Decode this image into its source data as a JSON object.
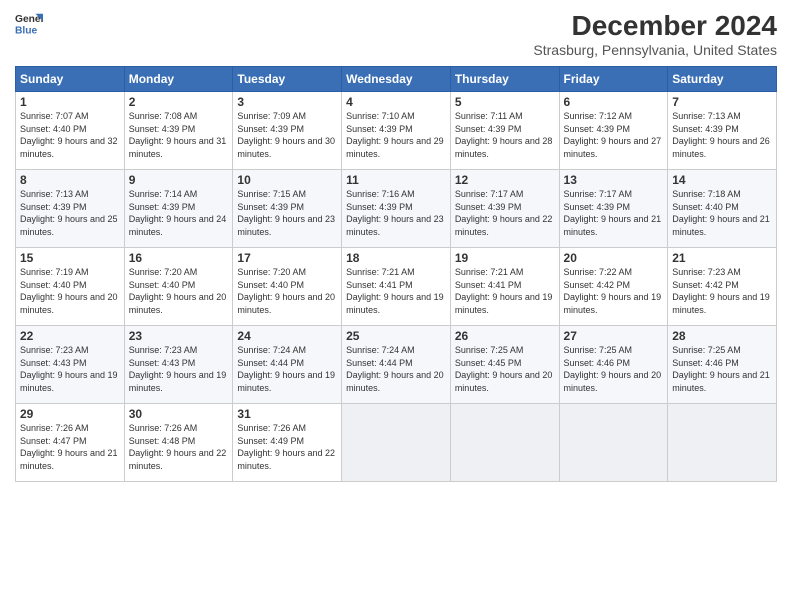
{
  "logo": {
    "line1": "General",
    "line2": "Blue"
  },
  "title": "December 2024",
  "subtitle": "Strasburg, Pennsylvania, United States",
  "days_header": [
    "Sunday",
    "Monday",
    "Tuesday",
    "Wednesday",
    "Thursday",
    "Friday",
    "Saturday"
  ],
  "weeks": [
    [
      {
        "day": "1",
        "sunrise": "7:07 AM",
        "sunset": "4:40 PM",
        "daylight": "9 hours and 32 minutes."
      },
      {
        "day": "2",
        "sunrise": "7:08 AM",
        "sunset": "4:39 PM",
        "daylight": "9 hours and 31 minutes."
      },
      {
        "day": "3",
        "sunrise": "7:09 AM",
        "sunset": "4:39 PM",
        "daylight": "9 hours and 30 minutes."
      },
      {
        "day": "4",
        "sunrise": "7:10 AM",
        "sunset": "4:39 PM",
        "daylight": "9 hours and 29 minutes."
      },
      {
        "day": "5",
        "sunrise": "7:11 AM",
        "sunset": "4:39 PM",
        "daylight": "9 hours and 28 minutes."
      },
      {
        "day": "6",
        "sunrise": "7:12 AM",
        "sunset": "4:39 PM",
        "daylight": "9 hours and 27 minutes."
      },
      {
        "day": "7",
        "sunrise": "7:13 AM",
        "sunset": "4:39 PM",
        "daylight": "9 hours and 26 minutes."
      }
    ],
    [
      {
        "day": "8",
        "sunrise": "7:13 AM",
        "sunset": "4:39 PM",
        "daylight": "9 hours and 25 minutes."
      },
      {
        "day": "9",
        "sunrise": "7:14 AM",
        "sunset": "4:39 PM",
        "daylight": "9 hours and 24 minutes."
      },
      {
        "day": "10",
        "sunrise": "7:15 AM",
        "sunset": "4:39 PM",
        "daylight": "9 hours and 23 minutes."
      },
      {
        "day": "11",
        "sunrise": "7:16 AM",
        "sunset": "4:39 PM",
        "daylight": "9 hours and 23 minutes."
      },
      {
        "day": "12",
        "sunrise": "7:17 AM",
        "sunset": "4:39 PM",
        "daylight": "9 hours and 22 minutes."
      },
      {
        "day": "13",
        "sunrise": "7:17 AM",
        "sunset": "4:39 PM",
        "daylight": "9 hours and 21 minutes."
      },
      {
        "day": "14",
        "sunrise": "7:18 AM",
        "sunset": "4:40 PM",
        "daylight": "9 hours and 21 minutes."
      }
    ],
    [
      {
        "day": "15",
        "sunrise": "7:19 AM",
        "sunset": "4:40 PM",
        "daylight": "9 hours and 20 minutes."
      },
      {
        "day": "16",
        "sunrise": "7:20 AM",
        "sunset": "4:40 PM",
        "daylight": "9 hours and 20 minutes."
      },
      {
        "day": "17",
        "sunrise": "7:20 AM",
        "sunset": "4:40 PM",
        "daylight": "9 hours and 20 minutes."
      },
      {
        "day": "18",
        "sunrise": "7:21 AM",
        "sunset": "4:41 PM",
        "daylight": "9 hours and 19 minutes."
      },
      {
        "day": "19",
        "sunrise": "7:21 AM",
        "sunset": "4:41 PM",
        "daylight": "9 hours and 19 minutes."
      },
      {
        "day": "20",
        "sunrise": "7:22 AM",
        "sunset": "4:42 PM",
        "daylight": "9 hours and 19 minutes."
      },
      {
        "day": "21",
        "sunrise": "7:23 AM",
        "sunset": "4:42 PM",
        "daylight": "9 hours and 19 minutes."
      }
    ],
    [
      {
        "day": "22",
        "sunrise": "7:23 AM",
        "sunset": "4:43 PM",
        "daylight": "9 hours and 19 minutes."
      },
      {
        "day": "23",
        "sunrise": "7:23 AM",
        "sunset": "4:43 PM",
        "daylight": "9 hours and 19 minutes."
      },
      {
        "day": "24",
        "sunrise": "7:24 AM",
        "sunset": "4:44 PM",
        "daylight": "9 hours and 19 minutes."
      },
      {
        "day": "25",
        "sunrise": "7:24 AM",
        "sunset": "4:44 PM",
        "daylight": "9 hours and 20 minutes."
      },
      {
        "day": "26",
        "sunrise": "7:25 AM",
        "sunset": "4:45 PM",
        "daylight": "9 hours and 20 minutes."
      },
      {
        "day": "27",
        "sunrise": "7:25 AM",
        "sunset": "4:46 PM",
        "daylight": "9 hours and 20 minutes."
      },
      {
        "day": "28",
        "sunrise": "7:25 AM",
        "sunset": "4:46 PM",
        "daylight": "9 hours and 21 minutes."
      }
    ],
    [
      {
        "day": "29",
        "sunrise": "7:26 AM",
        "sunset": "4:47 PM",
        "daylight": "9 hours and 21 minutes."
      },
      {
        "day": "30",
        "sunrise": "7:26 AM",
        "sunset": "4:48 PM",
        "daylight": "9 hours and 22 minutes."
      },
      {
        "day": "31",
        "sunrise": "7:26 AM",
        "sunset": "4:49 PM",
        "daylight": "9 hours and 22 minutes."
      },
      null,
      null,
      null,
      null
    ]
  ]
}
